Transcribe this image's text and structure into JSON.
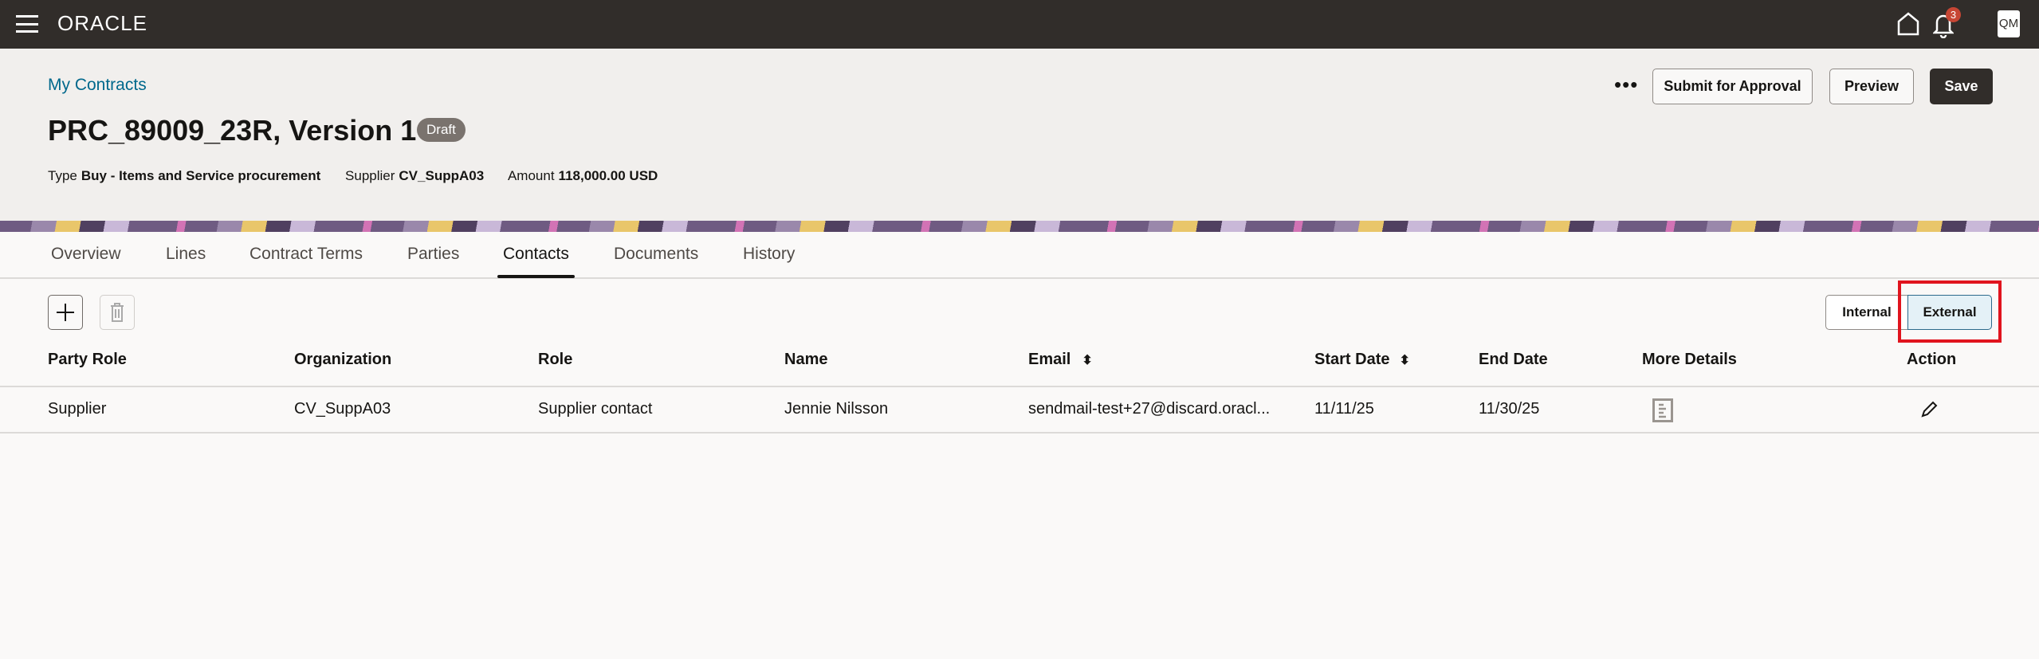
{
  "topbar": {
    "logo": "ORACLE",
    "notifications": "3",
    "avatar": "QM",
    "icons": [
      "menu-icon",
      "home-icon",
      "bell-icon"
    ]
  },
  "header": {
    "breadcrumb": "My Contracts",
    "title": "PRC_89009_23R, Version 1",
    "status": "Draft",
    "meta": [
      {
        "label": "Type",
        "value": "Buy - Items and Service procurement"
      },
      {
        "label": "Supplier",
        "value": "CV_SuppA03"
      },
      {
        "label": "Amount",
        "value": "118,000.00 USD"
      }
    ],
    "more": "•••",
    "submit": "Submit for Approval",
    "preview": "Preview",
    "save": "Save"
  },
  "tabs": [
    "Overview",
    "Lines",
    "Contract Terms",
    "Parties",
    "Contacts",
    "Documents",
    "History"
  ],
  "toggle": {
    "internal": "Internal",
    "external": "External",
    "selected": "External"
  },
  "table": {
    "headers": [
      "Party Role",
      "Organization",
      "Role",
      "Name",
      "Email",
      "Start Date",
      "End Date",
      "More Details",
      "Action"
    ],
    "rows": [
      [
        "Supplier",
        "CV_SuppA03",
        "Supplier contact",
        "Jennie Nilsson",
        "sendmail-test+27@discard.oracl...",
        "11/11/25",
        "11/30/25"
      ]
    ]
  }
}
